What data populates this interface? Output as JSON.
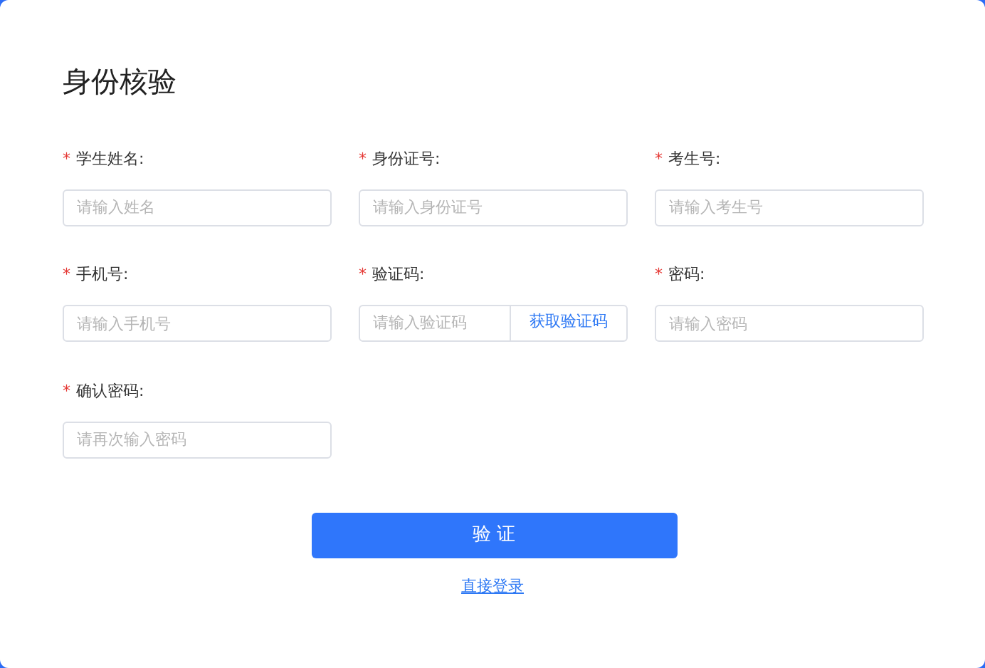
{
  "title": "身份核验",
  "fields": [
    {
      "kind": "text",
      "required_mark": "*",
      "label": "学生姓名:",
      "placeholder": "请输入姓名"
    },
    {
      "kind": "text",
      "required_mark": "*",
      "label": "身份证号:",
      "placeholder": "请输入身份证号"
    },
    {
      "kind": "text",
      "required_mark": "*",
      "label": "考生号:",
      "placeholder": "请输入考生号"
    },
    {
      "kind": "text",
      "required_mark": "*",
      "label": "手机号:",
      "placeholder": "请输入手机号"
    },
    {
      "kind": "code",
      "required_mark": "*",
      "label": "验证码:",
      "placeholder": "请输入验证码",
      "button": "获取验证码"
    },
    {
      "kind": "text",
      "required_mark": "*",
      "label": "密码:",
      "placeholder": "请输入密码"
    },
    {
      "kind": "text",
      "required_mark": "*",
      "label": "确认密码:",
      "placeholder": "请再次输入密码"
    }
  ],
  "submit_button": "验 证",
  "login_link": "直接登录"
}
